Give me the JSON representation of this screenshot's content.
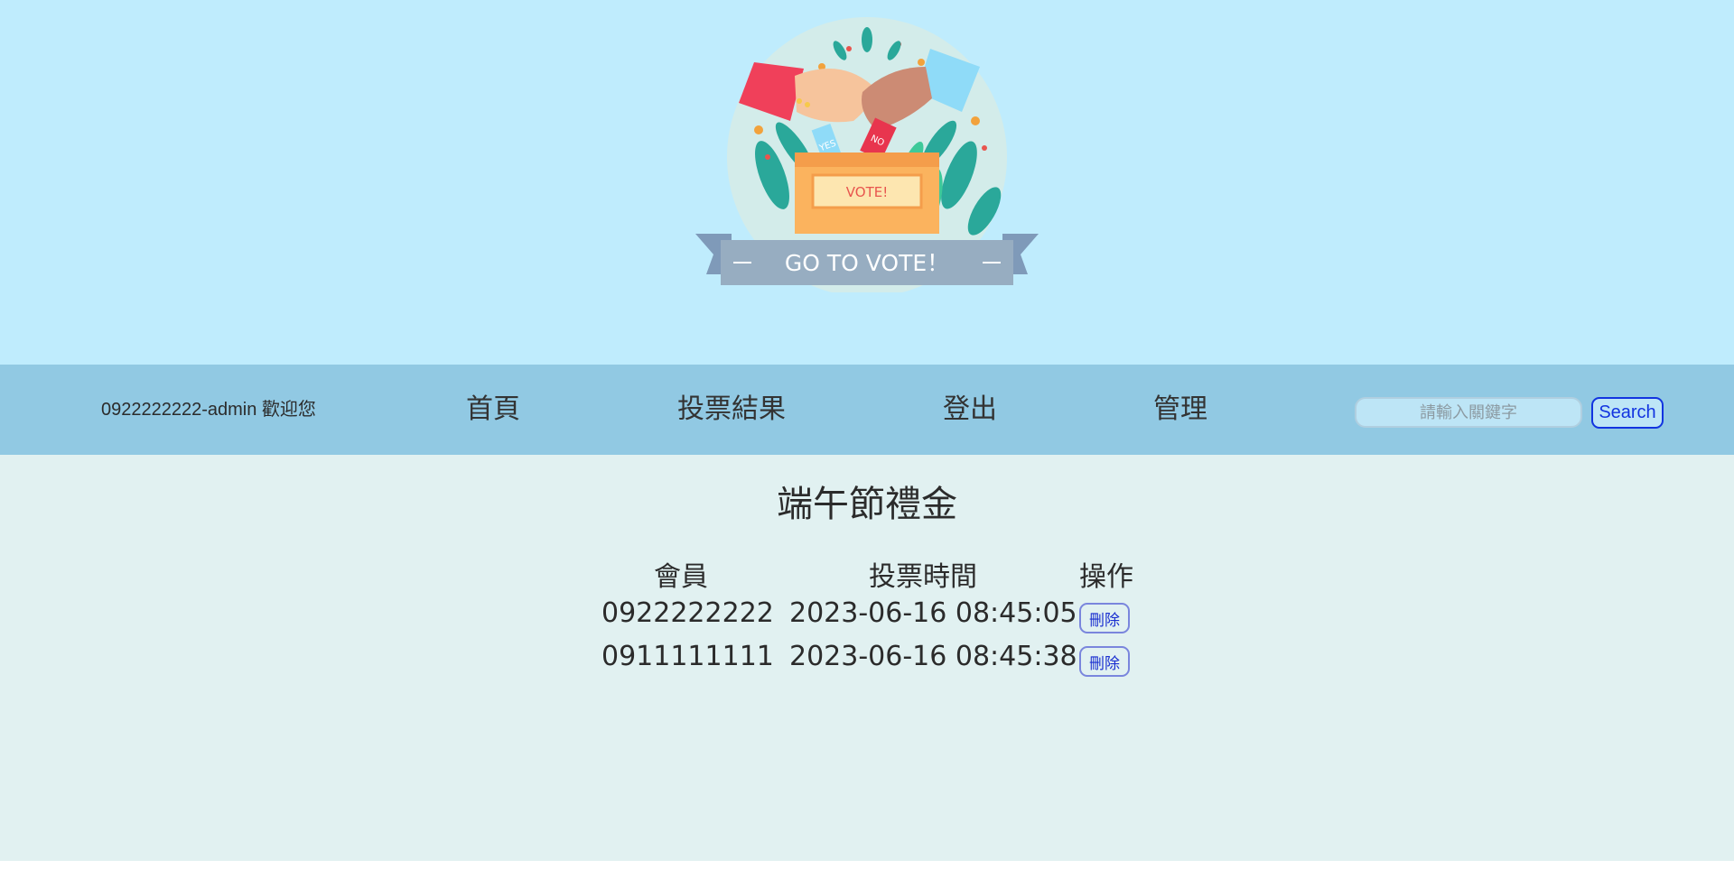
{
  "header": {
    "logo": {
      "icon": "go-to-vote-logo",
      "ballot_yes": "YES",
      "ballot_no": "NO",
      "box_label": "VOTE!",
      "banner": "GO TO VOTE！"
    }
  },
  "nav": {
    "welcome": "0922222222-admin 歡迎您",
    "links": [
      "首頁",
      "投票結果",
      "登出",
      "管理"
    ],
    "search_placeholder": "請輸入關鍵字",
    "search_value": "",
    "search_label": "Search"
  },
  "main": {
    "title": "端午節禮金",
    "headers": [
      "會員",
      "投票時間",
      "操作"
    ],
    "rows": [
      {
        "member": "0922222222",
        "time": "2023-06-16 08:45:05",
        "action": "刪除"
      },
      {
        "member": "0911111111",
        "time": "2023-06-16 08:45:38",
        "action": "刪除"
      }
    ]
  },
  "colors": {
    "header_bg": "#bfecfd",
    "nav_bg": "#91c9e3",
    "main_bg": "#e1f1f1",
    "link_blue": "#1234e0"
  }
}
